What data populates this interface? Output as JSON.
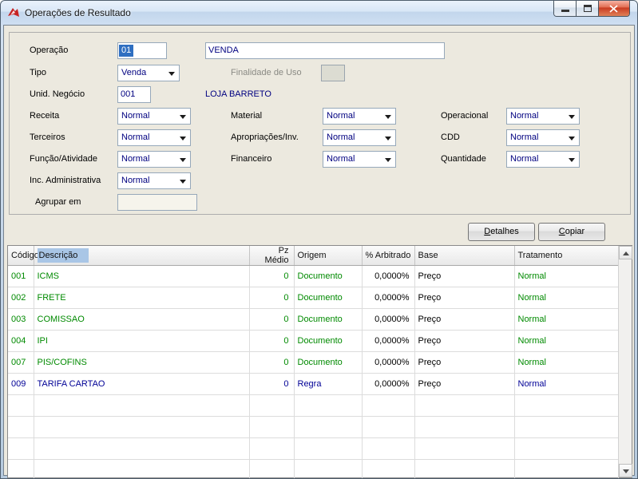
{
  "window": {
    "title": "Operações de Resultado"
  },
  "form": {
    "operacao": {
      "label": "Operação",
      "code": "01",
      "name": "VENDA"
    },
    "tipo": {
      "label": "Tipo",
      "value": "Venda"
    },
    "finalidade": {
      "label": "Finalidade de Uso",
      "value": ""
    },
    "unid_negocio": {
      "label": "Unid. Negócio",
      "value": "001",
      "empresa": "LOJA BARRETO"
    },
    "receita": {
      "label": "Receita",
      "value": "Normal"
    },
    "material": {
      "label": "Material",
      "value": "Normal"
    },
    "operacional": {
      "label": "Operacional",
      "value": "Normal"
    },
    "terceiros": {
      "label": "Terceiros",
      "value": "Normal"
    },
    "apropriacoes": {
      "label": "Apropriações/Inv.",
      "value": "Normal"
    },
    "cdd": {
      "label": "CDD",
      "value": "Normal"
    },
    "funcao_atividade": {
      "label": "Função/Atividade",
      "value": "Normal"
    },
    "financeiro": {
      "label": "Financeiro",
      "value": "Normal"
    },
    "quantidade": {
      "label": "Quantidade",
      "value": "Normal"
    },
    "inc_administrativa": {
      "label": "Inc. Administrativa",
      "value": "Normal"
    },
    "agrupar_em": {
      "label": "Agrupar em",
      "value": ""
    }
  },
  "buttons": {
    "detalhes": {
      "accel": "D",
      "rest": "etalhes"
    },
    "copiar": {
      "accel": "C",
      "rest": "opiar"
    }
  },
  "grid": {
    "columns": [
      "Código",
      "Descrição",
      "Pz Médio",
      "Origem",
      "% Arbitrado",
      "Base",
      "Tratamento"
    ],
    "rows": [
      {
        "codigo": "001",
        "descricao": "ICMS",
        "pz_medio": "0",
        "origem": "Documento",
        "arbitrado": "0,0000%",
        "base": "Preço",
        "tratamento": "Normal",
        "color": "#008a00"
      },
      {
        "codigo": "002",
        "descricao": "FRETE",
        "pz_medio": "0",
        "origem": "Documento",
        "arbitrado": "0,0000%",
        "base": "Preço",
        "tratamento": "Normal",
        "color": "#008a00"
      },
      {
        "codigo": "003",
        "descricao": "COMISSAO",
        "pz_medio": "0",
        "origem": "Documento",
        "arbitrado": "0,0000%",
        "base": "Preço",
        "tratamento": "Normal",
        "color": "#008a00"
      },
      {
        "codigo": "004",
        "descricao": "IPI",
        "pz_medio": "0",
        "origem": "Documento",
        "arbitrado": "0,0000%",
        "base": "Preço",
        "tratamento": "Normal",
        "color": "#008a00"
      },
      {
        "codigo": "007",
        "descricao": "PIS/COFINS",
        "pz_medio": "0",
        "origem": "Documento",
        "arbitrado": "0,0000%",
        "base": "Preço",
        "tratamento": "Normal",
        "color": "#008a00"
      },
      {
        "codigo": "009",
        "descricao": "TARIFA CARTAO",
        "pz_medio": "0",
        "origem": "Regra",
        "arbitrado": "0,0000%",
        "base": "Preço",
        "tratamento": "Normal",
        "color": "#000096"
      }
    ],
    "neutral_text_color": "#000000",
    "empty_row_count": 4
  },
  "colors": {
    "selection_bg": "#2f6fc1",
    "value_text": "#000080",
    "row_green": "#008a00",
    "row_navy": "#000096"
  }
}
